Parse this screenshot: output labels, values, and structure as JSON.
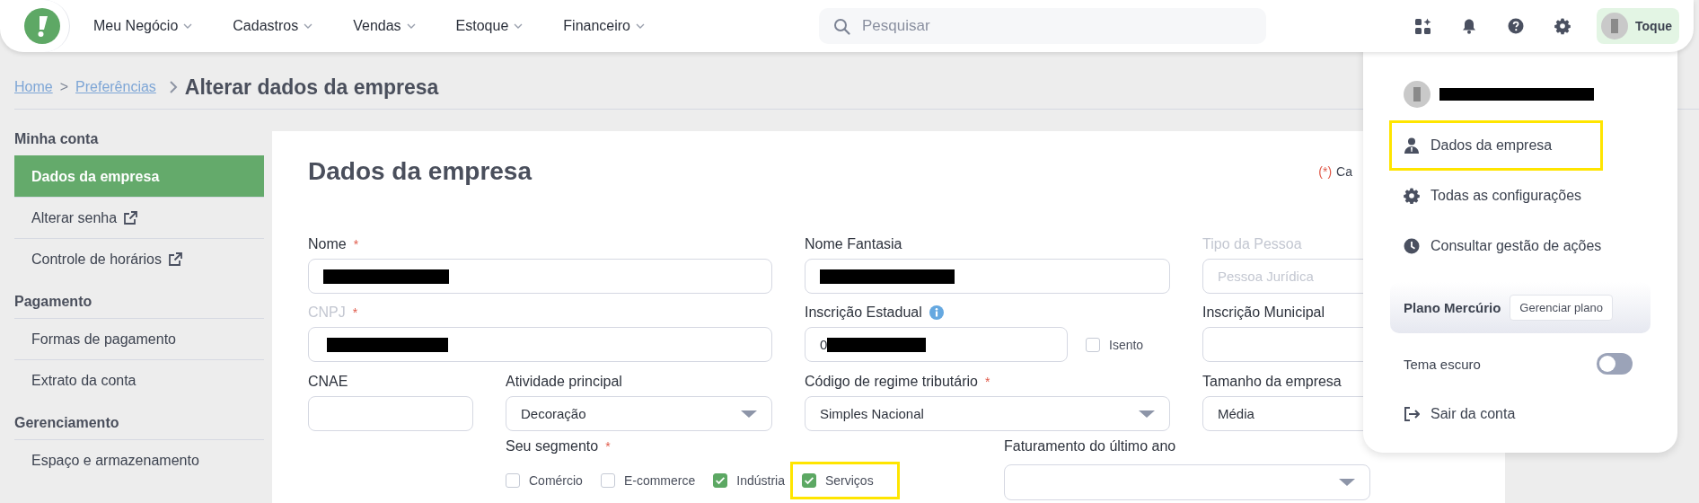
{
  "top_bar": {
    "menu": [
      {
        "label": "Meu Negócio"
      },
      {
        "label": "Cadastros"
      },
      {
        "label": "Vendas"
      },
      {
        "label": "Estoque"
      },
      {
        "label": "Financeiro"
      }
    ],
    "search": {
      "placeholder": "Pesquisar"
    },
    "user_chip": {
      "label": "Toque"
    }
  },
  "breadcrumb": {
    "links": [
      "Home",
      "Preferências"
    ],
    "separator": ">",
    "current": "Alterar dados da empresa"
  },
  "sidebar": {
    "sections": [
      {
        "title": "Minha conta",
        "items": [
          {
            "label": "Dados da empresa",
            "selected": true,
            "external": false
          },
          {
            "label": "Alterar senha",
            "selected": false,
            "external": true
          },
          {
            "label": "Controle de horários",
            "selected": false,
            "external": true
          }
        ]
      },
      {
        "title": "Pagamento",
        "items": [
          {
            "label": "Formas de pagamento",
            "selected": false,
            "external": false
          },
          {
            "label": "Extrato da conta",
            "selected": false,
            "external": false
          }
        ]
      },
      {
        "title": "Gerenciamento",
        "items": [
          {
            "label": "Espaço e armazenamento",
            "selected": false,
            "external": false
          }
        ]
      }
    ]
  },
  "form": {
    "title": "Dados da empresa",
    "required_note": {
      "mark": "(*)",
      "text": "Ca"
    },
    "rows": [
      {
        "fields": [
          {
            "kind": "text",
            "label": "Nome",
            "required_mark": "*",
            "disabled": false,
            "redacted": true
          },
          {
            "kind": "text",
            "label": "Nome Fantasia",
            "disabled": false,
            "redacted": true
          },
          {
            "kind": "text",
            "label": "Tipo da Pessoa",
            "disabled": true,
            "placeholder": "Pessoa Jurídica"
          }
        ]
      },
      {
        "fields": [
          {
            "kind": "text",
            "label": "CNPJ",
            "required_mark": "*",
            "disabled": true,
            "redacted": true
          },
          {
            "kind": "text",
            "label": "Inscrição Estadual",
            "disabled": false,
            "info": true,
            "value": "0",
            "redacted": true,
            "option": {
              "label": "Isento",
              "checked": false
            }
          },
          {
            "kind": "text",
            "label": "Inscrição Municipal",
            "disabled": false
          }
        ]
      },
      {
        "fields": [
          {
            "kind": "text",
            "label": "CNAE",
            "disabled": false
          },
          {
            "kind": "select",
            "label": "Atividade principal",
            "disabled": false,
            "value": "Decoração"
          },
          {
            "kind": "select",
            "label": "Código de regime tributário",
            "required_mark": "*",
            "disabled": false,
            "value": "Simples Nacional"
          },
          {
            "kind": "text",
            "label": "Tamanho da empresa",
            "disabled": false,
            "value": "Média"
          }
        ]
      },
      {
        "fields": [
          {
            "kind": "checkboxes",
            "label": "Seu segmento",
            "required_mark": "*",
            "disabled": false,
            "options": [
              {
                "label": "Comércio",
                "checked": false,
                "highlighted": false
              },
              {
                "label": "E-commerce",
                "checked": false,
                "highlighted": false
              },
              {
                "label": "Indústria",
                "checked": true,
                "highlighted": false
              },
              {
                "label": "Serviços",
                "checked": true,
                "highlighted": true
              }
            ]
          },
          {
            "kind": "select",
            "label": "Faturamento do último ano",
            "disabled": false
          }
        ]
      }
    ]
  },
  "account_menu": {
    "account": {
      "name_redacted": true
    },
    "items": [
      {
        "kind": "person",
        "label": "Dados da empresa",
        "highlighted": true
      },
      {
        "kind": "gear",
        "label": "Todas as configurações",
        "highlighted": false
      },
      {
        "kind": "clock",
        "label": "Consultar gestão de ações",
        "highlighted": false
      }
    ],
    "plan": {
      "name": "Plano Mercúrio",
      "button": "Gerenciar plano"
    },
    "dark_theme": {
      "label": "Tema escuro",
      "on": false
    },
    "logout": {
      "label": "Sair da conta"
    }
  }
}
